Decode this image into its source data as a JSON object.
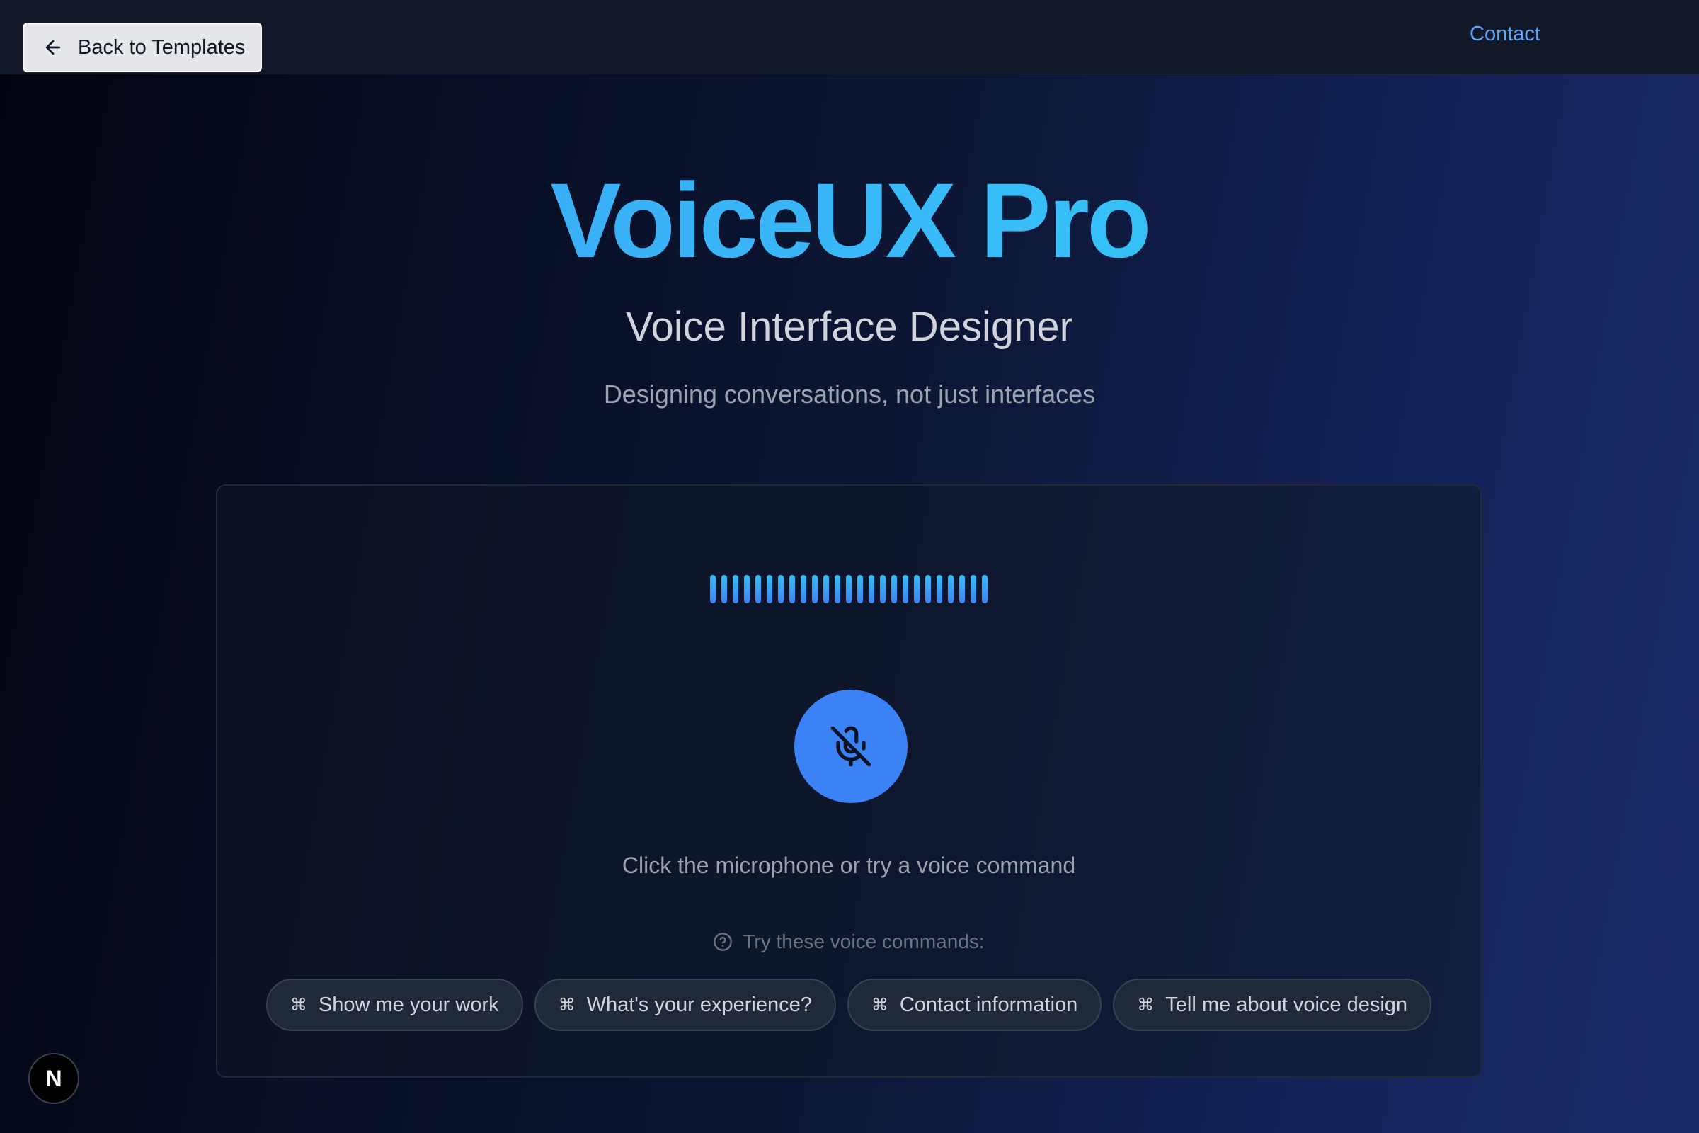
{
  "nav": {
    "back_label": "Back to Templates",
    "contact_label": "Contact"
  },
  "hero": {
    "title": "VoiceUX Pro",
    "subtitle": "Voice Interface Designer",
    "tagline": "Designing conversations, not just interfaces"
  },
  "voice_panel": {
    "waveform_bar_count": 25,
    "mic_state": "muted",
    "instruction": "Click the microphone or try a voice command",
    "commands_heading": "Try these voice commands:",
    "command_icon": "⌘",
    "commands": [
      "Show me your work",
      "What's your experience?",
      "Contact information",
      "Tell me about voice design"
    ]
  },
  "badge": {
    "letter": "N"
  },
  "colors": {
    "accent": "#3b82f6",
    "title_gradient_start": "#3b9ef5",
    "title_gradient_end": "#22d3ee",
    "link": "#60a5fa",
    "topbar": "#111827"
  },
  "icons": {
    "back": "arrow-left-icon",
    "mic": "mic-off-icon",
    "help": "help-circle-icon",
    "command": "command-icon"
  }
}
